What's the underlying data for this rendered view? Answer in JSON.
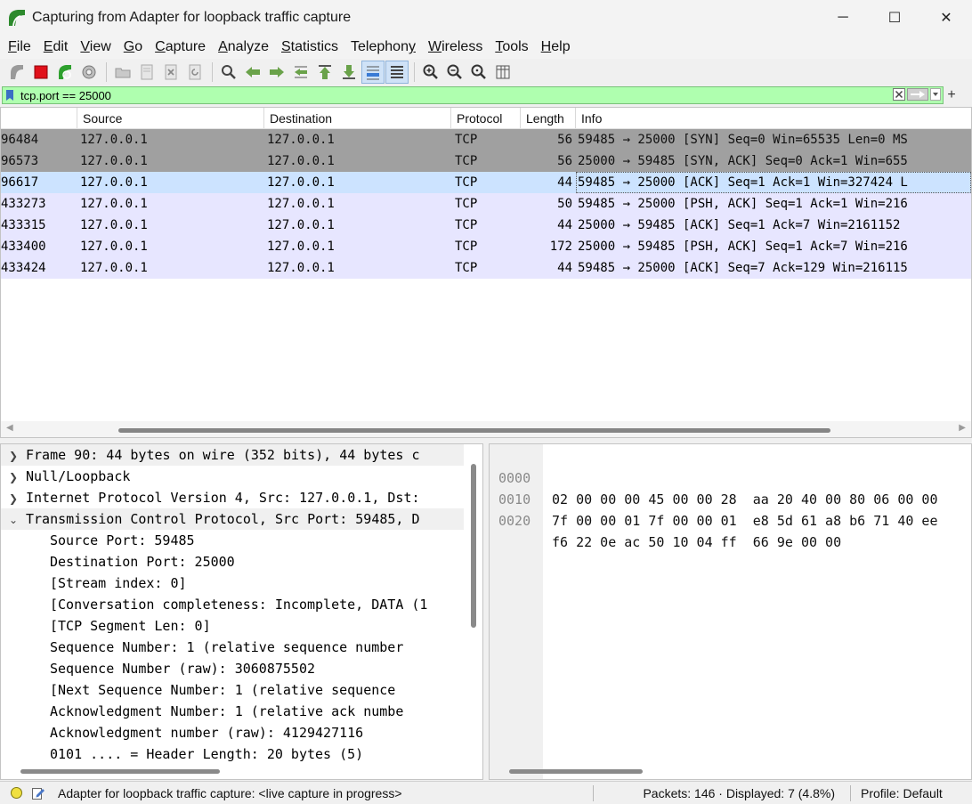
{
  "window": {
    "title": "Capturing from Adapter for loopback traffic capture",
    "controls": {
      "minimize": "─",
      "maximize": "☐",
      "close": "✕"
    }
  },
  "menu": [
    {
      "u": "F",
      "rest": "ile"
    },
    {
      "u": "E",
      "rest": "dit"
    },
    {
      "u": "V",
      "rest": "iew"
    },
    {
      "u": "G",
      "rest": "o"
    },
    {
      "u": "C",
      "rest": "apture"
    },
    {
      "u": "A",
      "rest": "nalyze"
    },
    {
      "u": "S",
      "rest": "tatistics"
    },
    {
      "u": "",
      "rest": "Telephony",
      "first": "Telephon",
      "ul": "y"
    },
    {
      "u": "W",
      "rest": "ireless"
    },
    {
      "u": "T",
      "rest": "ools"
    },
    {
      "u": "H",
      "rest": "elp"
    }
  ],
  "toolbar": {
    "icons": [
      "start-capture-icon",
      "stop-capture-icon",
      "restart-capture-icon",
      "capture-options-icon",
      "open-file-icon",
      "save-file-icon",
      "close-file-icon",
      "reload-file-icon",
      "find-packet-icon",
      "go-back-icon",
      "go-forward-icon",
      "go-to-packet-icon",
      "go-first-icon",
      "go-last-icon",
      "auto-scroll-icon",
      "colorize-icon",
      "zoom-in-icon",
      "zoom-out-icon",
      "zoom-normal-icon",
      "resize-columns-icon"
    ]
  },
  "filter": {
    "value": "tcp.port == 25000"
  },
  "packet_list": {
    "columns": [
      "",
      "Source",
      "Destination",
      "Protocol",
      "Length",
      "Info"
    ],
    "rows": [
      {
        "time": "96484",
        "src": "127.0.0.1",
        "dst": "127.0.0.1",
        "proto": "TCP",
        "len": "56",
        "info": "59485 → 25000 [SYN] Seq=0 Win=65535 Len=0 MS",
        "style": "gray"
      },
      {
        "time": "96573",
        "src": "127.0.0.1",
        "dst": "127.0.0.1",
        "proto": "TCP",
        "len": "56",
        "info": "25000 → 59485 [SYN, ACK] Seq=0 Ack=1 Win=655",
        "style": "gray"
      },
      {
        "time": "96617",
        "src": "127.0.0.1",
        "dst": "127.0.0.1",
        "proto": "TCP",
        "len": "44",
        "info": "59485 → 25000 [ACK] Seq=1 Ack=1 Win=327424 L",
        "style": "sel"
      },
      {
        "time": "433273",
        "src": "127.0.0.1",
        "dst": "127.0.0.1",
        "proto": "TCP",
        "len": "50",
        "info": "59485 → 25000 [PSH, ACK] Seq=1 Ack=1 Win=216",
        "style": "lav"
      },
      {
        "time": "433315",
        "src": "127.0.0.1",
        "dst": "127.0.0.1",
        "proto": "TCP",
        "len": "44",
        "info": "25000 → 59485 [ACK] Seq=1 Ack=7 Win=2161152",
        "style": "lav"
      },
      {
        "time": "433400",
        "src": "127.0.0.1",
        "dst": "127.0.0.1",
        "proto": "TCP",
        "len": "172",
        "info": "25000 → 59485 [PSH, ACK] Seq=1 Ack=7 Win=216",
        "style": "lav"
      },
      {
        "time": "433424",
        "src": "127.0.0.1",
        "dst": "127.0.0.1",
        "proto": "TCP",
        "len": "44",
        "info": "59485 → 25000 [ACK] Seq=7 Ack=129 Win=216115",
        "style": "lav"
      }
    ]
  },
  "details": {
    "top": [
      {
        "text": "Frame 90: 44 bytes on wire (352 bits), 44 bytes c",
        "expanded": false
      },
      {
        "text": "Null/Loopback",
        "expanded": false
      },
      {
        "text": "Internet Protocol Version 4, Src: 127.0.0.1, Dst:",
        "expanded": false
      },
      {
        "text": "Transmission Control Protocol, Src Port: 59485, D",
        "expanded": true
      }
    ],
    "children": [
      "Source Port: 59485",
      "Destination Port: 25000",
      "[Stream index: 0]",
      "[Conversation completeness: Incomplete, DATA (1",
      "[TCP Segment Len: 0]",
      "Sequence Number: 1    (relative sequence number",
      "Sequence Number (raw): 3060875502",
      "[Next Sequence Number: 1    (relative sequence",
      "Acknowledgment Number: 1    (relative ack numbe",
      "Acknowledgment number (raw): 4129427116",
      "0101 .... = Header Length: 20 bytes (5)"
    ]
  },
  "bytes": {
    "rows": [
      {
        "offset": "0000",
        "hex": "02 00 00 00 45 00 00 28  aa 20 40 00 80 06 00 00"
      },
      {
        "offset": "0010",
        "hex": "7f 00 00 01 7f 00 00 01  e8 5d 61 a8 b6 71 40 ee"
      },
      {
        "offset": "0020",
        "hex": "f6 22 0e ac 50 10 04 ff  66 9e 00 00"
      }
    ]
  },
  "status": {
    "message": "Adapter for loopback traffic capture: <live capture in progress>",
    "packets": "Packets: 146 · Displayed: 7 (4.8%)",
    "profile": "Profile: Default"
  },
  "colors": {
    "filter_valid": "#afffaf",
    "row_selected": "#cce3ff",
    "row_gray": "#a0a0a0",
    "row_lavender": "#e7e6ff"
  }
}
